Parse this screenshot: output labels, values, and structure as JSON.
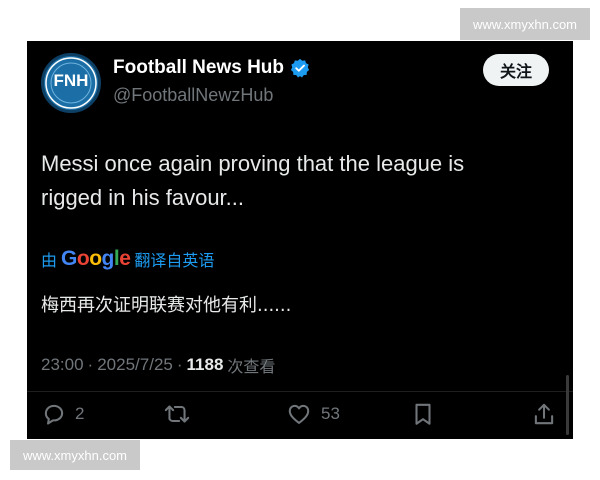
{
  "watermark": {
    "top": "www.xmyxhn.com",
    "bottom": "www.xmyxhn.com"
  },
  "account": {
    "avatar_text": "FNH",
    "name": "Football News Hub",
    "handle": "@FootballNewzHub",
    "verified_icon": "verified-badge-icon"
  },
  "follow_label": "关注",
  "tweet": {
    "text_line1": "Messi once again proving that the league is",
    "text_line2": "rigged in his favour..."
  },
  "translate": {
    "by": "由",
    "google": [
      "G",
      "o",
      "o",
      "g",
      "l",
      "e"
    ],
    "suffix": "翻译自英语"
  },
  "translated_text": "梅西再次证明联赛对他有利......",
  "meta": {
    "time": "23:00",
    "sep1": "·",
    "date": "2025/7/25",
    "sep2": "·",
    "views_count": "1188",
    "views_label": "次查看"
  },
  "actions": {
    "reply_count": "2",
    "like_count": "53"
  },
  "colors": {
    "background": "#000000",
    "link_blue": "#1d9bf0",
    "muted": "#71767b",
    "text": "#e7e9ea"
  }
}
